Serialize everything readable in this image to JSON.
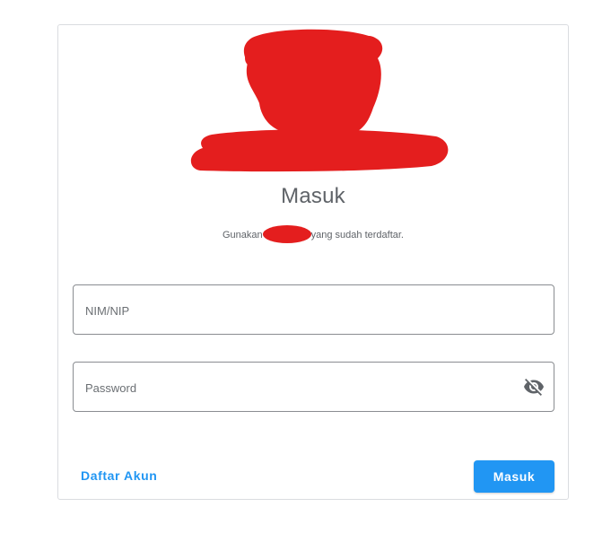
{
  "login": {
    "title": "Masuk",
    "subtitle_before": "Gunakan",
    "subtitle_after": "yang sudah terdaftar.",
    "nim_placeholder": "NIM/NIP",
    "password_placeholder": "Password",
    "register_label": "Daftar Akun",
    "submit_label": "Masuk"
  },
  "colors": {
    "accent": "#2196f3",
    "redaction": "#e41e1e",
    "text_muted": "#5f6368"
  },
  "icons": {
    "password_toggle": "eye-off-icon"
  }
}
